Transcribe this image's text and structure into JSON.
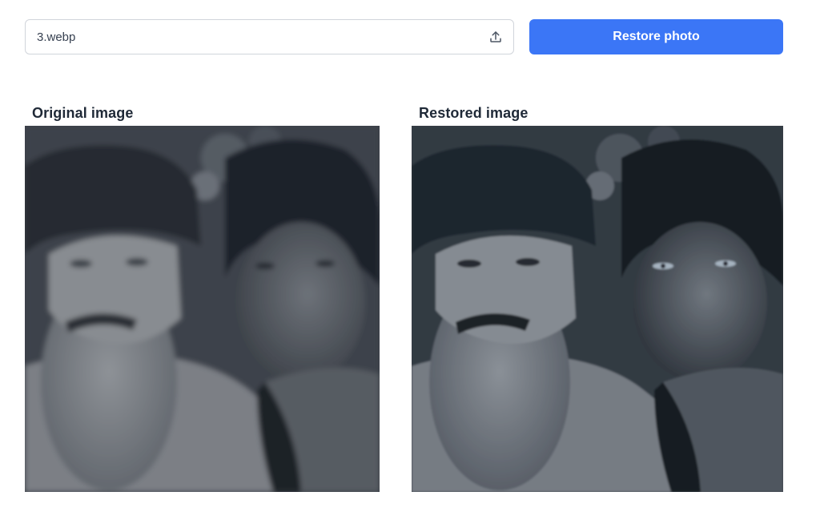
{
  "upload": {
    "file_name": "3.webp",
    "icon": "upload-icon"
  },
  "actions": {
    "restore_label": "Restore photo",
    "accent_color": "#3b76f6"
  },
  "panels": {
    "original": {
      "label": "Original image"
    },
    "restored": {
      "label": "Restored image"
    }
  }
}
